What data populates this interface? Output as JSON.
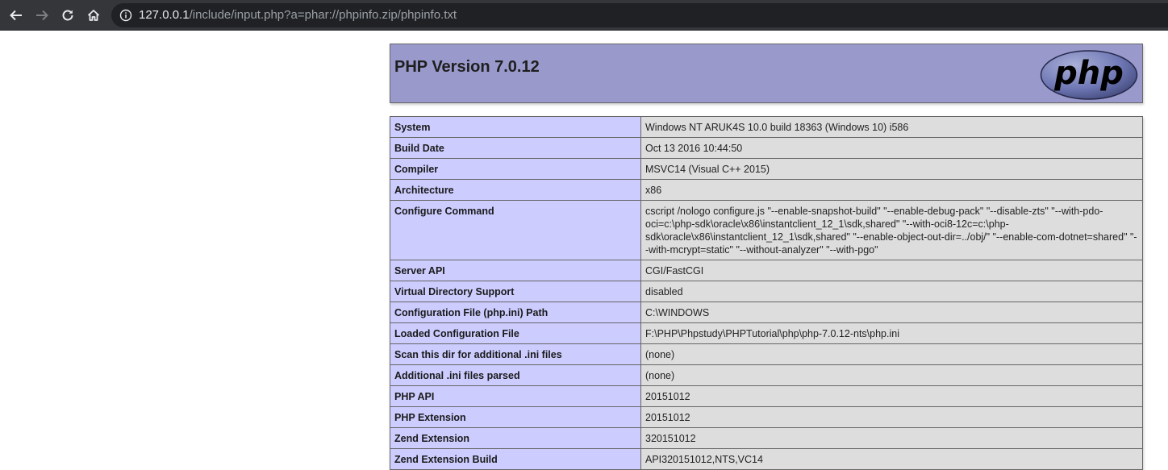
{
  "browser": {
    "url_host": "127.0.0.1",
    "url_rest": "/include/input.php?a=phar://phpinfo.zip/phpinfo.txt"
  },
  "header": {
    "title": "PHP Version 7.0.12",
    "logo_text": "php"
  },
  "rows": [
    {
      "k": "System",
      "v": "Windows NT ARUK4S 10.0 build 18363 (Windows 10) i586"
    },
    {
      "k": "Build Date",
      "v": "Oct 13 2016 10:44:50"
    },
    {
      "k": "Compiler",
      "v": "MSVC14 (Visual C++ 2015)"
    },
    {
      "k": "Architecture",
      "v": "x86"
    },
    {
      "k": "Configure Command",
      "v": "cscript /nologo configure.js \"--enable-snapshot-build\" \"--enable-debug-pack\" \"--disable-zts\" \"--with-pdo-oci=c:\\php-sdk\\oracle\\x86\\instantclient_12_1\\sdk,shared\" \"--with-oci8-12c=c:\\php-sdk\\oracle\\x86\\instantclient_12_1\\sdk,shared\" \"--enable-object-out-dir=../obj/\" \"--enable-com-dotnet=shared\" \"--with-mcrypt=static\" \"--without-analyzer\" \"--with-pgo\""
    },
    {
      "k": "Server API",
      "v": "CGI/FastCGI"
    },
    {
      "k": "Virtual Directory Support",
      "v": "disabled"
    },
    {
      "k": "Configuration File (php.ini) Path",
      "v": "C:\\WINDOWS"
    },
    {
      "k": "Loaded Configuration File",
      "v": "F:\\PHP\\Phpstudy\\PHPTutorial\\php\\php-7.0.12-nts\\php.ini"
    },
    {
      "k": "Scan this dir for additional .ini files",
      "v": "(none)"
    },
    {
      "k": "Additional .ini files parsed",
      "v": "(none)"
    },
    {
      "k": "PHP API",
      "v": "20151012"
    },
    {
      "k": "PHP Extension",
      "v": "20151012"
    },
    {
      "k": "Zend Extension",
      "v": "320151012"
    },
    {
      "k": "Zend Extension Build",
      "v": "API320151012,NTS,VC14"
    }
  ],
  "colors": {
    "header_bg": "#9999cc",
    "key_bg": "#ccccff",
    "value_bg": "#dddddd",
    "toolbar_bg": "#35363a"
  }
}
